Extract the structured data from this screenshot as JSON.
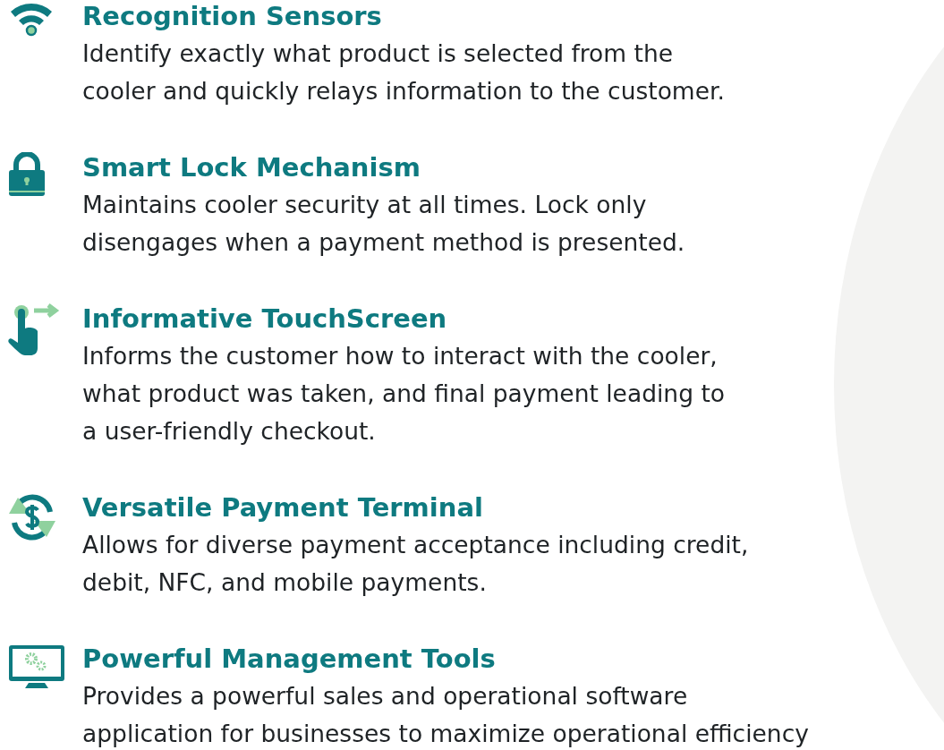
{
  "features": [
    {
      "kind": "sensor",
      "title": "Recognition Sensors",
      "lines": [
        "Identify exactly what product is selected from the",
        "cooler and quickly relays information to the customer."
      ]
    },
    {
      "kind": "lock",
      "title": "Smart Lock Mechanism",
      "lines": [
        "Maintains cooler security at all times. Lock only",
        "disengages when a payment method is presented."
      ]
    },
    {
      "kind": "touch",
      "title": "Informative TouchScreen",
      "lines": [
        "Informs the customer how to interact with the cooler,",
        "what product was taken, and final payment leading to",
        "a user-friendly checkout."
      ]
    },
    {
      "kind": "payment",
      "title": "Versatile Payment Terminal",
      "lines": [
        "Allows for diverse payment acceptance including credit,",
        "debit, NFC, and mobile payments."
      ]
    },
    {
      "kind": "management",
      "title": "Powerful Management Tools",
      "lines": [
        "Provides a powerful sales and operational software",
        "application for businesses to maximize operational efficiency"
      ]
    }
  ]
}
